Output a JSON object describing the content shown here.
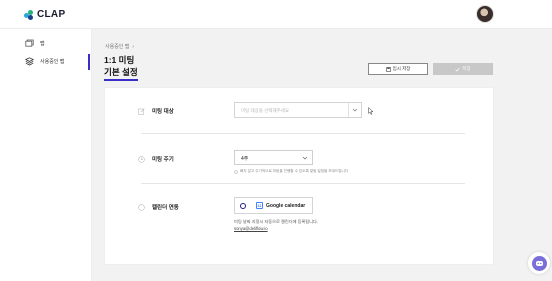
{
  "header": {
    "logo_text": "CLAP"
  },
  "sidebar": {
    "items": [
      {
        "label": "맵",
        "icon": "map-icon"
      },
      {
        "label": "사용중인 맵",
        "icon": "layers-icon",
        "active": true
      }
    ]
  },
  "breadcrumb": {
    "item": "사용중인 맵",
    "separator": "›"
  },
  "page": {
    "title": "1:1 미팅",
    "tab_title": "기본 설정"
  },
  "actions": {
    "temp_save_label": "임시 저장",
    "save_label": "저장"
  },
  "form": {
    "target": {
      "label": "미팅 대상",
      "placeholder": "미팅 대상을 선택해주세요"
    },
    "cycle": {
      "label": "미팅 주기",
      "value": "4주",
      "hint": "빠지 않고 주기적으로 미팅을 진행할 수 있도록 알림 일정을 보내드립니다"
    },
    "calendar": {
      "label": "캘린더 연동",
      "option_label": "Google calendar",
      "description": "미팅 날짜 지정시 자동으로 캘린더에 등록됩니다.",
      "email": "sonya@deliflow.io"
    }
  },
  "colors": {
    "accent": "#3a2ec8",
    "save_disabled": "#c8c8c8",
    "chat": "#7a6fd8"
  }
}
